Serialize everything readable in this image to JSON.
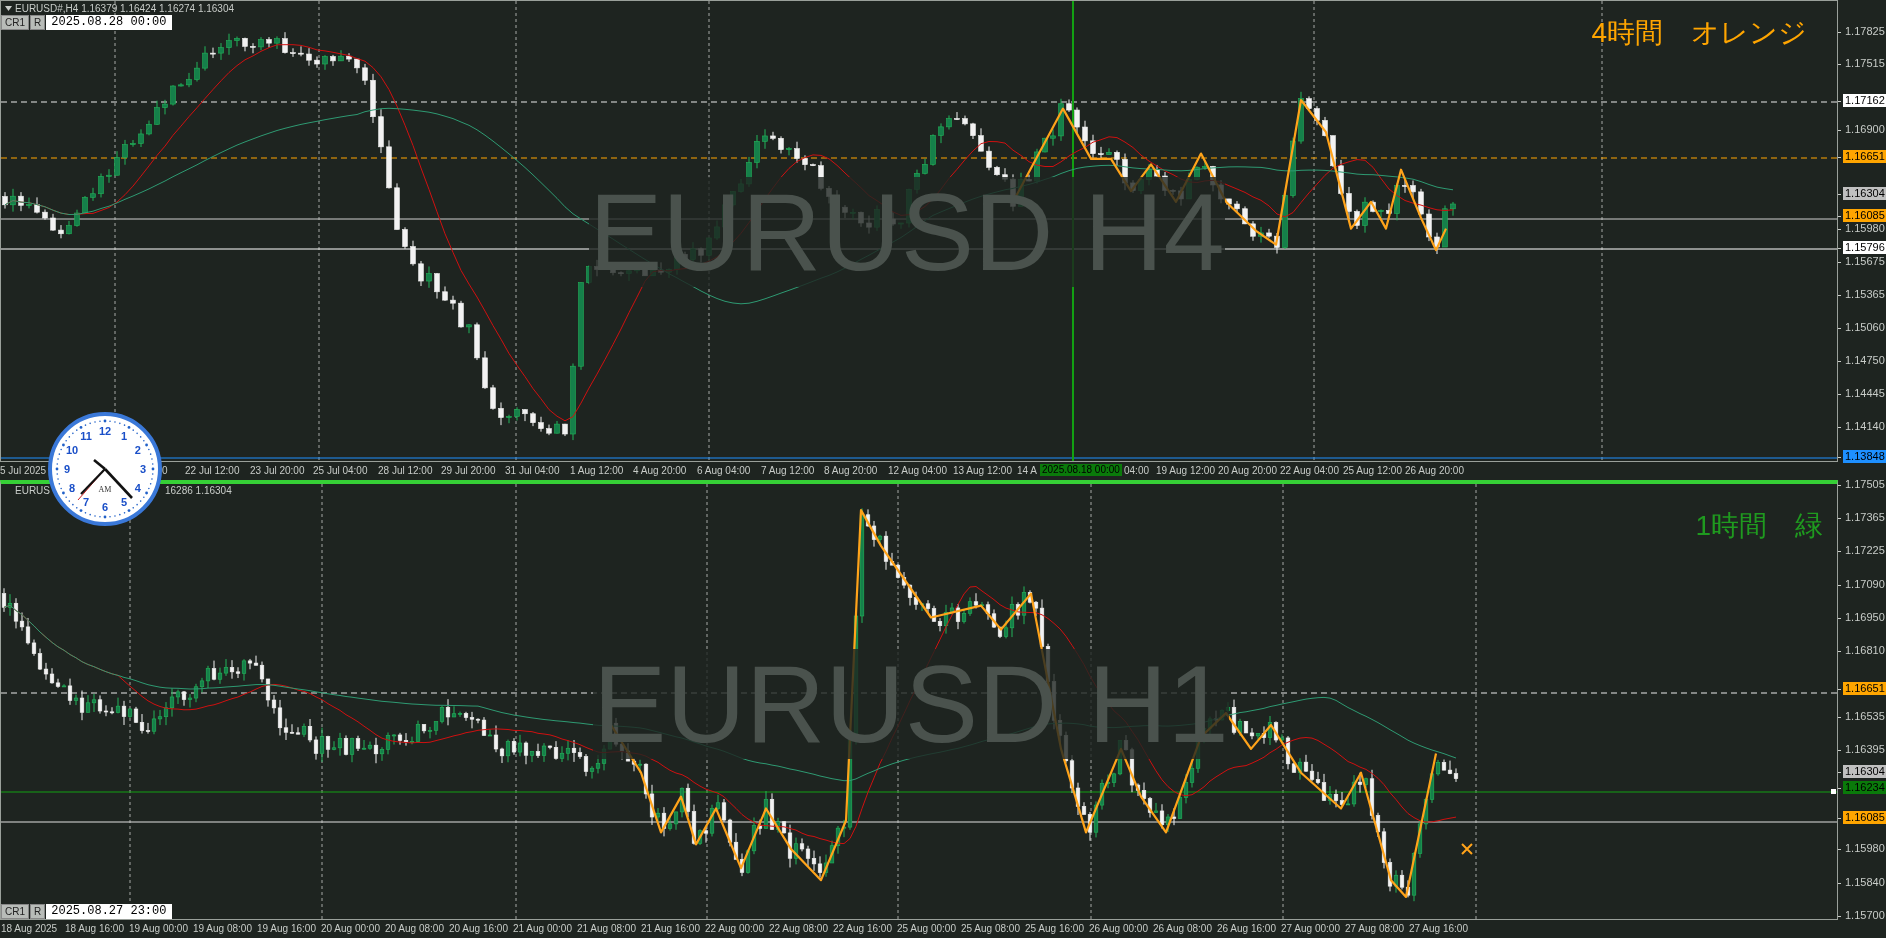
{
  "top_chart": {
    "header": "EURUSD#,H4  1.16379 1.16424 1.16274 1.16304",
    "buttons": [
      "CR1",
      "R"
    ],
    "date_field": "2025.08.28 00:00",
    "watermark": "EURUSD H4",
    "note": "4時間　オレンジ",
    "price_labels": [
      {
        "text": "1.17825",
        "kind": "tick"
      },
      {
        "text": "1.17515",
        "kind": "tick"
      },
      {
        "text": "1.17162",
        "kind": "white"
      },
      {
        "text": "1.16900",
        "kind": "tick"
      },
      {
        "text": "1.16651",
        "kind": "orange"
      },
      {
        "text": "1.16304",
        "kind": "gray"
      },
      {
        "text": "1.16085",
        "kind": "orange"
      },
      {
        "text": "1.15980",
        "kind": "tick"
      },
      {
        "text": "1.15796",
        "kind": "white"
      },
      {
        "text": "1.15675",
        "kind": "tick"
      },
      {
        "text": "1.15365",
        "kind": "tick"
      },
      {
        "text": "1.15060",
        "kind": "tick"
      },
      {
        "text": "1.14750",
        "kind": "tick"
      },
      {
        "text": "1.14445",
        "kind": "tick"
      },
      {
        "text": "1.14140",
        "kind": "tick"
      },
      {
        "text": "1.13848",
        "kind": "blue"
      }
    ],
    "time_labels": [
      {
        "text": "5 Jul 2025",
        "kind": "plain"
      },
      {
        "text": "0",
        "kind": "plain"
      },
      {
        "text": "22 Jul 12:00",
        "kind": "plain"
      },
      {
        "text": "23 Jul 20:00",
        "kind": "plain"
      },
      {
        "text": "25 Jul 04:00",
        "kind": "plain"
      },
      {
        "text": "28 Jul 12:00",
        "kind": "plain"
      },
      {
        "text": "29 Jul 20:00",
        "kind": "plain"
      },
      {
        "text": "31 Jul 04:00",
        "kind": "plain"
      },
      {
        "text": "1 Aug 12:00",
        "kind": "plain"
      },
      {
        "text": "4 Aug 20:00",
        "kind": "plain"
      },
      {
        "text": "6 Aug 04:00",
        "kind": "plain"
      },
      {
        "text": "7 Aug 12:00",
        "kind": "plain"
      },
      {
        "text": "8 Aug 20:00",
        "kind": "plain"
      },
      {
        "text": "12 Aug 04:00",
        "kind": "plain"
      },
      {
        "text": "13 Aug 12:00",
        "kind": "plain"
      },
      {
        "text": "14 A",
        "kind": "plain"
      },
      {
        "text": "2025.08.18 00:00",
        "kind": "highlight"
      },
      {
        "text": "04:00",
        "kind": "plain"
      },
      {
        "text": "19 Aug 12:00",
        "kind": "plain"
      },
      {
        "text": "20 Aug 20:00",
        "kind": "plain"
      },
      {
        "text": "22 Aug 04:00",
        "kind": "plain"
      },
      {
        "text": "25 Aug 12:00",
        "kind": "plain"
      },
      {
        "text": "26 Aug 20:00",
        "kind": "plain"
      }
    ]
  },
  "clock": {
    "numbers": [
      "12",
      "11",
      "1",
      "10",
      "2",
      "9",
      "3",
      "8",
      "4",
      "7",
      "5",
      "6"
    ],
    "period": "AM"
  },
  "bottom_chart": {
    "header": [
      "EURUS",
      "16286 1.16304"
    ],
    "buttons": [
      "CR1",
      "R"
    ],
    "date_field": "2025.08.27 23:00",
    "watermark": "EURUSD H1",
    "note": "1時間　緑",
    "price_labels": [
      {
        "text": "1.17505",
        "kind": "tick"
      },
      {
        "text": "1.17365",
        "kind": "tick"
      },
      {
        "text": "1.17225",
        "kind": "tick"
      },
      {
        "text": "1.17090",
        "kind": "tick"
      },
      {
        "text": "1.16950",
        "kind": "tick"
      },
      {
        "text": "1.16810",
        "kind": "tick"
      },
      {
        "text": "1.16651",
        "kind": "orange"
      },
      {
        "text": "1.16535",
        "kind": "tick"
      },
      {
        "text": "1.16395",
        "kind": "tick"
      },
      {
        "text": "1.16304",
        "kind": "gray"
      },
      {
        "text": "1.16234",
        "kind": "green"
      },
      {
        "text": "1.16085",
        "kind": "orange"
      },
      {
        "text": "1.15980",
        "kind": "tick"
      },
      {
        "text": "1.15840",
        "kind": "tick"
      },
      {
        "text": "1.15700",
        "kind": "tick"
      }
    ],
    "time_labels": [
      {
        "text": "18 Aug 2025",
        "kind": "plain"
      },
      {
        "text": "18 Aug 16:00",
        "kind": "plain"
      },
      {
        "text": "19 Aug 00:00",
        "kind": "plain"
      },
      {
        "text": "19 Aug 08:00",
        "kind": "plain"
      },
      {
        "text": "19 Aug 16:00",
        "kind": "plain"
      },
      {
        "text": "20 Aug 00:00",
        "kind": "plain"
      },
      {
        "text": "20 Aug 08:00",
        "kind": "plain"
      },
      {
        "text": "20 Aug 16:00",
        "kind": "plain"
      },
      {
        "text": "21 Aug 00:00",
        "kind": "plain"
      },
      {
        "text": "21 Aug 08:00",
        "kind": "plain"
      },
      {
        "text": "21 Aug 16:00",
        "kind": "plain"
      },
      {
        "text": "22 Aug 00:00",
        "kind": "plain"
      },
      {
        "text": "22 Aug 08:00",
        "kind": "plain"
      },
      {
        "text": "22 Aug 16:00",
        "kind": "plain"
      },
      {
        "text": "25 Aug 00:00",
        "kind": "plain"
      },
      {
        "text": "25 Aug 08:00",
        "kind": "plain"
      },
      {
        "text": "25 Aug 16:00",
        "kind": "plain"
      },
      {
        "text": "26 Aug 00:00",
        "kind": "plain"
      },
      {
        "text": "26 Aug 08:00",
        "kind": "plain"
      },
      {
        "text": "26 Aug 16:00",
        "kind": "plain"
      },
      {
        "text": "27 Aug 00:00",
        "kind": "plain"
      },
      {
        "text": "27 Aug 08:00",
        "kind": "plain"
      },
      {
        "text": "27 Aug 16:00",
        "kind": "plain"
      }
    ]
  }
}
